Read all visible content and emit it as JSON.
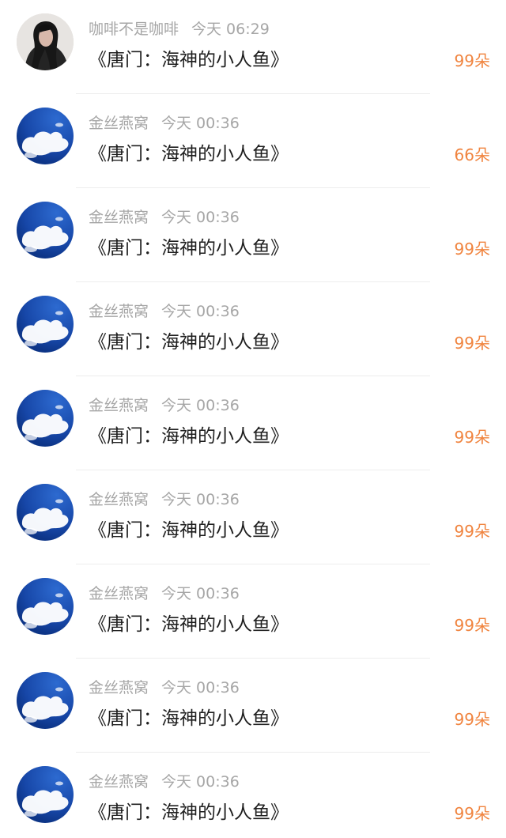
{
  "gift_records": [
    {
      "avatar": "portrait-avatar",
      "username": "咖啡不是咖啡",
      "time": "今天 06:29",
      "title": "《唐门：海神的小人鱼》",
      "amount": "99朵"
    },
    {
      "avatar": "sky-cloud-avatar",
      "username": "金丝燕窝",
      "time": "今天 00:36",
      "title": "《唐门：海神的小人鱼》",
      "amount": "66朵"
    },
    {
      "avatar": "sky-cloud-avatar",
      "username": "金丝燕窝",
      "time": "今天 00:36",
      "title": "《唐门：海神的小人鱼》",
      "amount": "99朵"
    },
    {
      "avatar": "sky-cloud-avatar",
      "username": "金丝燕窝",
      "time": "今天 00:36",
      "title": "《唐门：海神的小人鱼》",
      "amount": "99朵"
    },
    {
      "avatar": "sky-cloud-avatar",
      "username": "金丝燕窝",
      "time": "今天 00:36",
      "title": "《唐门：海神的小人鱼》",
      "amount": "99朵"
    },
    {
      "avatar": "sky-cloud-avatar",
      "username": "金丝燕窝",
      "time": "今天 00:36",
      "title": "《唐门：海神的小人鱼》",
      "amount": "99朵"
    },
    {
      "avatar": "sky-cloud-avatar",
      "username": "金丝燕窝",
      "time": "今天 00:36",
      "title": "《唐门：海神的小人鱼》",
      "amount": "99朵"
    },
    {
      "avatar": "sky-cloud-avatar",
      "username": "金丝燕窝",
      "time": "今天 00:36",
      "title": "《唐门：海神的小人鱼》",
      "amount": "99朵"
    },
    {
      "avatar": "sky-cloud-avatar",
      "username": "金丝燕窝",
      "time": "今天 00:36",
      "title": "《唐门：海神的小人鱼》",
      "amount": "99朵"
    }
  ],
  "colors": {
    "amount": "#f0843f",
    "meta": "#a6a6a6",
    "title": "#1f1f1f",
    "divider": "#ededed",
    "sky_avatar_bg": "#1747a8"
  }
}
